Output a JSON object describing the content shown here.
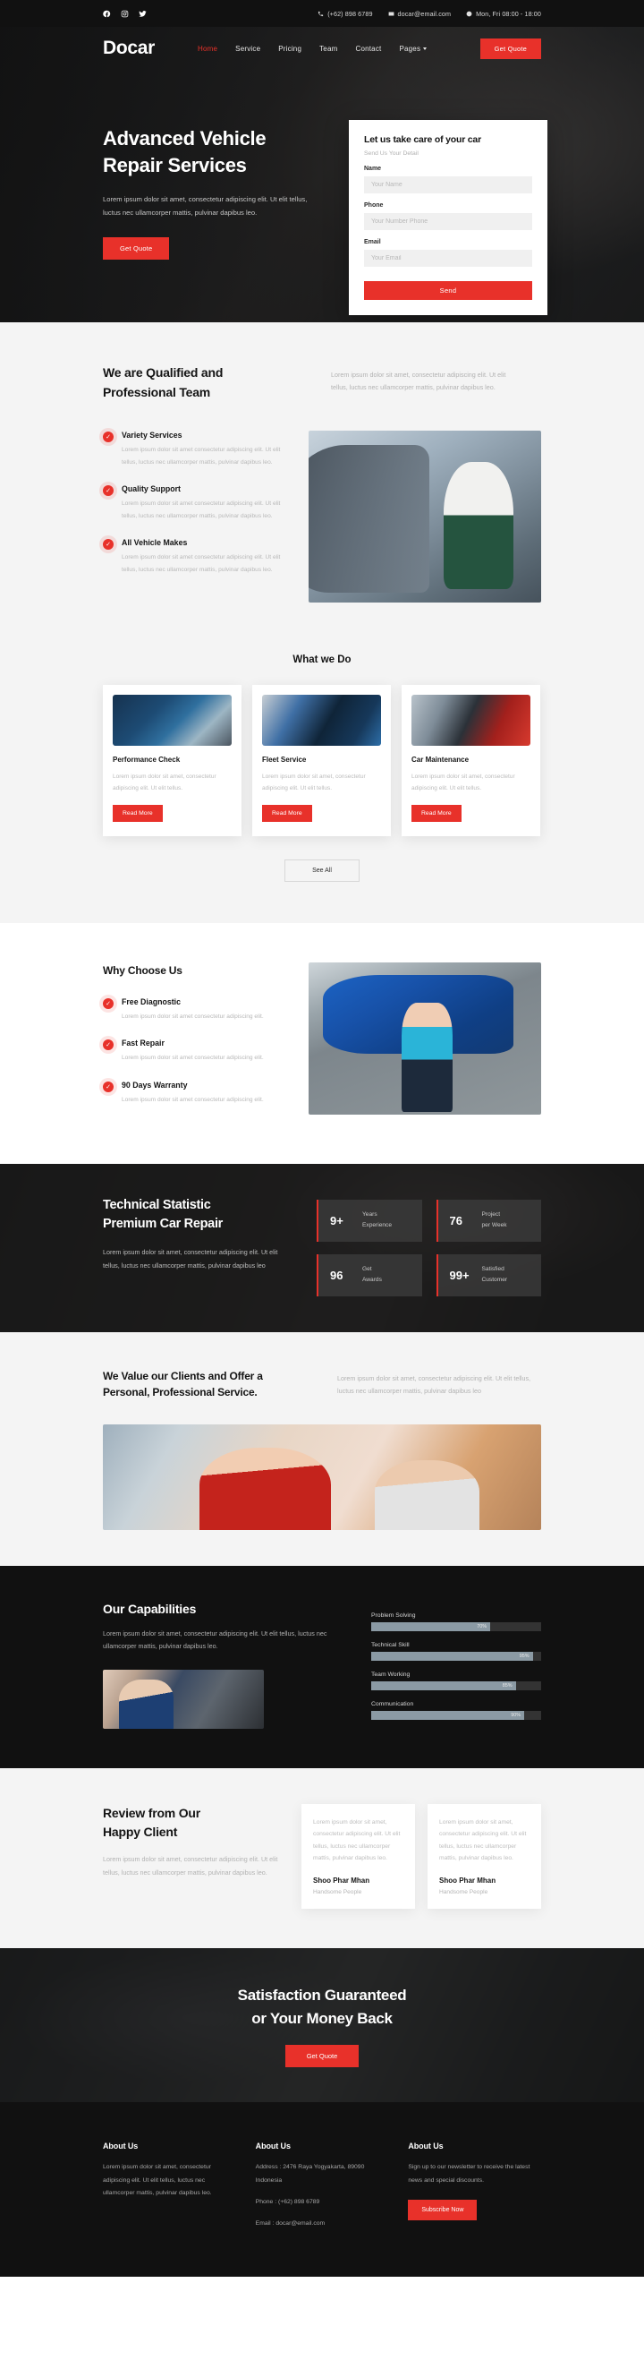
{
  "topbar": {
    "social": [
      {
        "name": "facebook-icon",
        "label": "Facebook"
      },
      {
        "name": "instagram-icon",
        "label": "Instagram"
      },
      {
        "name": "twitter-icon",
        "label": "Twitter"
      }
    ],
    "phone": "(+62) 898 6789",
    "email": "docar@email.com",
    "hours": "Mon, Fri 08:00 - 18:00"
  },
  "nav": {
    "brand": "Docar",
    "links": [
      {
        "label": "Home",
        "active": true
      },
      {
        "label": "Service",
        "active": false
      },
      {
        "label": "Pricing",
        "active": false
      },
      {
        "label": "Team",
        "active": false
      },
      {
        "label": "Contact",
        "active": false
      },
      {
        "label": "Pages",
        "active": false,
        "dropdown": true
      }
    ],
    "cta": "Get Quote"
  },
  "hero": {
    "title_line1": "Advanced Vehicle",
    "title_line2": "Repair Services",
    "paragraph": "Lorem ipsum dolor sit amet, consectetur adipiscing elit. Ut elit tellus, luctus nec ullamcorper mattis, pulvinar dapibus leo.",
    "cta": "Get Quote",
    "form": {
      "title": "Let us take care of your car",
      "subtitle": "Send Us Your Detail",
      "fields": [
        {
          "label": "Name",
          "placeholder": "Your Name",
          "value": ""
        },
        {
          "label": "Phone",
          "placeholder": "Your Number Phone",
          "value": ""
        },
        {
          "label": "Email",
          "placeholder": "Your Email",
          "value": ""
        }
      ],
      "submit": "Send"
    }
  },
  "qualified": {
    "title": "We are Qualified and Professional Team",
    "paragraph": "Lorem ipsum dolor sit amet, consectetur adipiscing elit. Ut elit tellus, luctus nec ullamcorper mattis, pulvinar dapibus leo.",
    "features": [
      {
        "title": "Variety Services",
        "text": "Lorem ipsum dolor sit amet consectetur adipiscing elit. Ut elit tellus, luctus nec ullamcorper mattis, pulvinar dapibus leo."
      },
      {
        "title": "Quality Support",
        "text": "Lorem ipsum dolor sit amet consectetur adipiscing elit. Ut elit tellus, luctus nec ullamcorper mattis, pulvinar dapibus leo."
      },
      {
        "title": "All Vehicle Makes",
        "text": "Lorem ipsum dolor sit amet consectetur adipiscing elit. Ut elit tellus, luctus nec ullamcorper mattis, pulvinar dapibus leo."
      }
    ]
  },
  "whatwedo": {
    "title": "What we Do",
    "cards": [
      {
        "title": "Performance Check",
        "text": "Lorem ipsum dolor sit amet, consectetur adipiscing elit. Ut elit tellus.",
        "button": "Read More"
      },
      {
        "title": "Fleet Service",
        "text": "Lorem ipsum dolor sit amet, consectetur adipiscing elit. Ut elit tellus.",
        "button": "Read More"
      },
      {
        "title": "Car Maintenance",
        "text": "Lorem ipsum dolor sit amet, consectetur adipiscing elit. Ut elit tellus.",
        "button": "Read More"
      }
    ],
    "see_all": "See All"
  },
  "whychoose": {
    "title": "Why Choose Us",
    "features": [
      {
        "title": "Free Diagnostic",
        "text": "Lorem ipsum dolor sit amet consectetur adipiscing elit."
      },
      {
        "title": "Fast Repair",
        "text": "Lorem ipsum dolor sit amet consectetur adipiscing elit."
      },
      {
        "title": "90 Days Warranty",
        "text": "Lorem ipsum dolor sit amet consectetur adipiscing elit."
      }
    ]
  },
  "stats": {
    "title_line1": "Technical Statistic",
    "title_line2": "Premium Car Repair",
    "paragraph": "Lorem ipsum dolor sit amet, consectetur adipiscing elit. Ut elit tellus, luctus nec ullamcorper mattis, pulvinar dapibus leo",
    "items": [
      {
        "value": "9+",
        "label_line1": "Years",
        "label_line2": "Experience"
      },
      {
        "value": "76",
        "label_line1": "Project",
        "label_line2": "per Week"
      },
      {
        "value": "96",
        "label_line1": "Get",
        "label_line2": "Awards"
      },
      {
        "value": "99+",
        "label_line1": "Satisfied",
        "label_line2": "Customer"
      }
    ]
  },
  "values": {
    "title": "We Value our Clients and Offer a Personal, Professional Service.",
    "paragraph": "Lorem ipsum dolor sit amet, consectetur adipiscing elit. Ut elit tellus, luctus nec ullamcorper mattis, pulvinar dapibus leo"
  },
  "capabilities": {
    "title": "Our Capabilities",
    "paragraph": "Lorem ipsum dolor sit amet, consectetur adipiscing elit. Ut elit tellus, luctus nec ullamcorper mattis, pulvinar dapibus leo.",
    "skills": [
      {
        "label": "Problem Solving",
        "percent": 70,
        "percent_label": "70%"
      },
      {
        "label": "Technical Skill",
        "percent": 95,
        "percent_label": "95%"
      },
      {
        "label": "Team Working",
        "percent": 85,
        "percent_label": "85%"
      },
      {
        "label": "Communication",
        "percent": 90,
        "percent_label": "90%"
      }
    ]
  },
  "reviews": {
    "title_line1": "Review from Our",
    "title_line2": "Happy Client",
    "paragraph": "Lorem ipsum dolor sit amet, consectetur adipiscing elit. Ut elit tellus, luctus nec ullamcorper mattis, pulvinar dapibus leo.",
    "cards": [
      {
        "quote": "Lorem ipsum dolor sit amet, consectetur adipiscing elit. Ut elit tellus, luctus nec ullamcorper mattis, pulvinar dapibus leo.",
        "name": "Shoo Phar Mhan",
        "role": "Handsome People"
      },
      {
        "quote": "Lorem ipsum dolor sit amet, consectetur adipiscing elit. Ut elit tellus, luctus nec ullamcorper mattis, pulvinar dapibus leo.",
        "name": "Shoo Phar Mhan",
        "role": "Handsome People"
      }
    ]
  },
  "cta": {
    "title_line1": "Satisfaction Guaranteed",
    "title_line2": "or Your Money Back",
    "button": "Get Quote"
  },
  "footer": {
    "col1": {
      "title": "About Us",
      "text": "Lorem ipsum dolor sit amet, consectetur adipiscing elit. Ut elit tellus, luctus nec ullamcorper mattis, pulvinar dapibus leo."
    },
    "col2": {
      "title": "About Us",
      "address": "Address : 2476 Raya Yogyakarta, 89090 Indonesia",
      "phone": "Phone : (+62) 898 6789",
      "email": "Email : docar@email.com"
    },
    "col3": {
      "title": "About Us",
      "text": "Sign up to our newsletter to receive the latest news and special discounts.",
      "button": "Subscribe Now"
    }
  },
  "colors": {
    "accent": "#e8312a",
    "dark": "#111111",
    "light": "#f4f4f4",
    "bar": "#8b9aa4"
  }
}
